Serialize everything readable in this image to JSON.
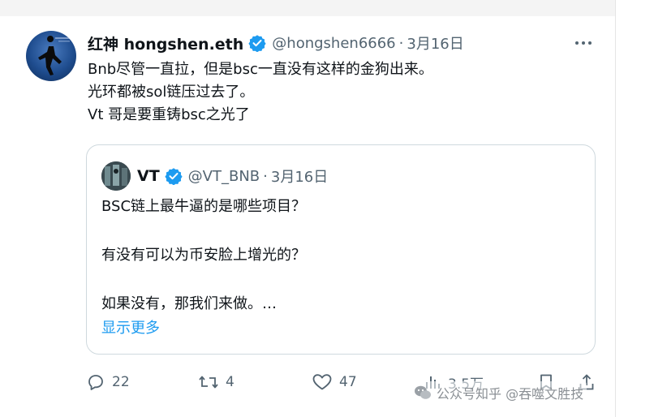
{
  "tweet": {
    "author_name": "红神 hongshen.eth",
    "author_handle": "@hongshen6666",
    "separator": "·",
    "date": "3月16日",
    "text_lines": [
      "Bnb尽管一直拉，但是bsc一直没有这样的金狗出来。",
      "光环都被sol链压过去了。",
      "Vt 哥是要重铸bsc之光了"
    ]
  },
  "quote": {
    "author_name": "VT",
    "author_handle": "@VT_BNB",
    "separator": "·",
    "date": "3月16日",
    "text_lines": [
      "BSC链上最牛逼的是哪些项目？",
      "有没有可以为币安脸上增光的？",
      "如果没有，那我们来做。…"
    ],
    "show_more": "显示更多"
  },
  "actions": {
    "replies": "22",
    "retweets": "4",
    "likes": "47",
    "views": "3.5万"
  },
  "watermark": {
    "text": "公众号知乎 @吞噬文胜技"
  },
  "colors": {
    "verified": "#1d9bf0",
    "link": "#1d9bf0",
    "muted": "#536471",
    "text": "#0f1419"
  },
  "icons": [
    "verified-badge-icon",
    "more-options-icon",
    "reply-icon",
    "retweet-icon",
    "like-icon",
    "views-icon",
    "bookmark-icon",
    "share-icon",
    "wechat-icon"
  ]
}
